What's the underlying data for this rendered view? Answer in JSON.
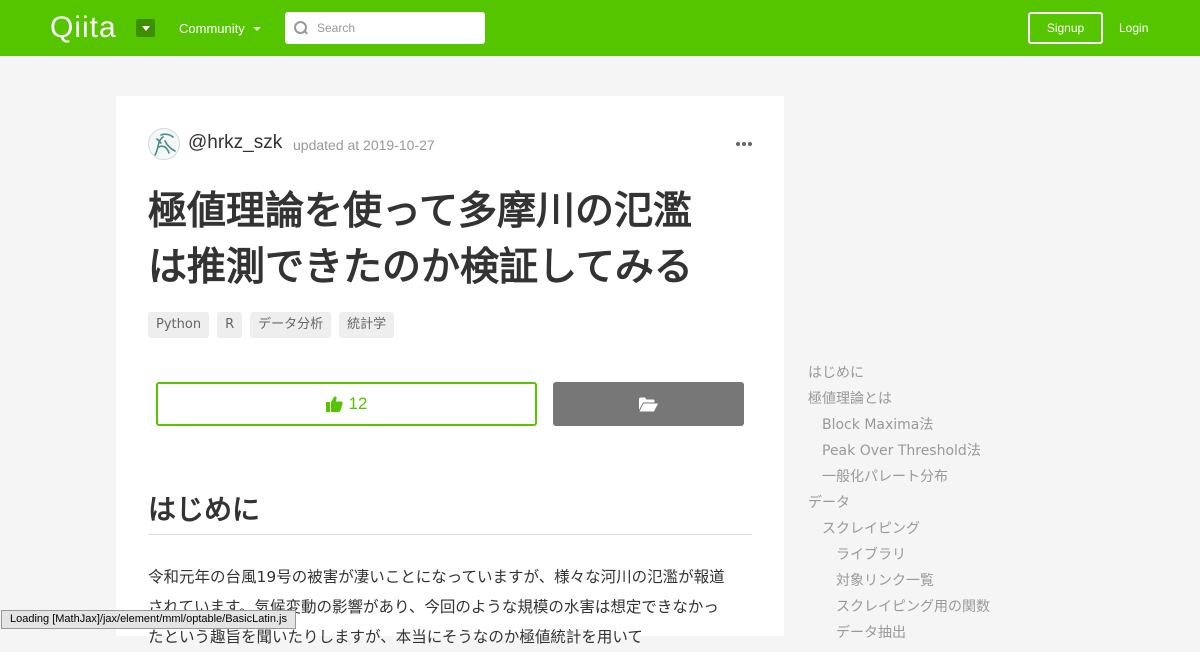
{
  "header": {
    "logo_text": "Qiita",
    "community_label": "Community",
    "search_placeholder": "Search",
    "signup_label": "Signup",
    "login_label": "Login",
    "brand_color": "#55c500"
  },
  "article": {
    "author": "@hrkz_szk",
    "updated": "updated at 2019-10-27",
    "title_line1": "極値理論を使って多摩川の氾濫",
    "title_line2": "は推測できたのか検証してみる",
    "tags": [
      "Python",
      "R",
      "データ分析",
      "統計学"
    ],
    "like_count": "12",
    "section_heading": "はじめに",
    "body_line1": "令和元年の台風19号の被害が凄いことになっていますが、様々な河川の氾濫が報道",
    "body_line2": "されています。気候変動の影響があり、今回のような規模の水害は想定できなかっ",
    "body_line3": "たという趣旨を聞いたりしますが、本当にそうなのか極値統計を用いて"
  },
  "toc": {
    "items": [
      {
        "label": "はじめに",
        "level": 1
      },
      {
        "label": "極値理論とは",
        "level": 1
      },
      {
        "label": "Block Maxima法",
        "level": 2
      },
      {
        "label": "Peak Over Threshold法",
        "level": 2
      },
      {
        "label": "一般化パレート分布",
        "level": 2
      },
      {
        "label": "データ",
        "level": 1
      },
      {
        "label": "スクレイピング",
        "level": 2
      },
      {
        "label": "ライブラリ",
        "level": 3
      },
      {
        "label": "対象リンク一覧",
        "level": 3
      },
      {
        "label": "スクレイピング用の関数",
        "level": 3
      },
      {
        "label": "データ抽出",
        "level": 3
      }
    ]
  },
  "status_bar": {
    "text": "Loading [MathJax]/jax/element/mml/optable/BasicLatin.js"
  }
}
